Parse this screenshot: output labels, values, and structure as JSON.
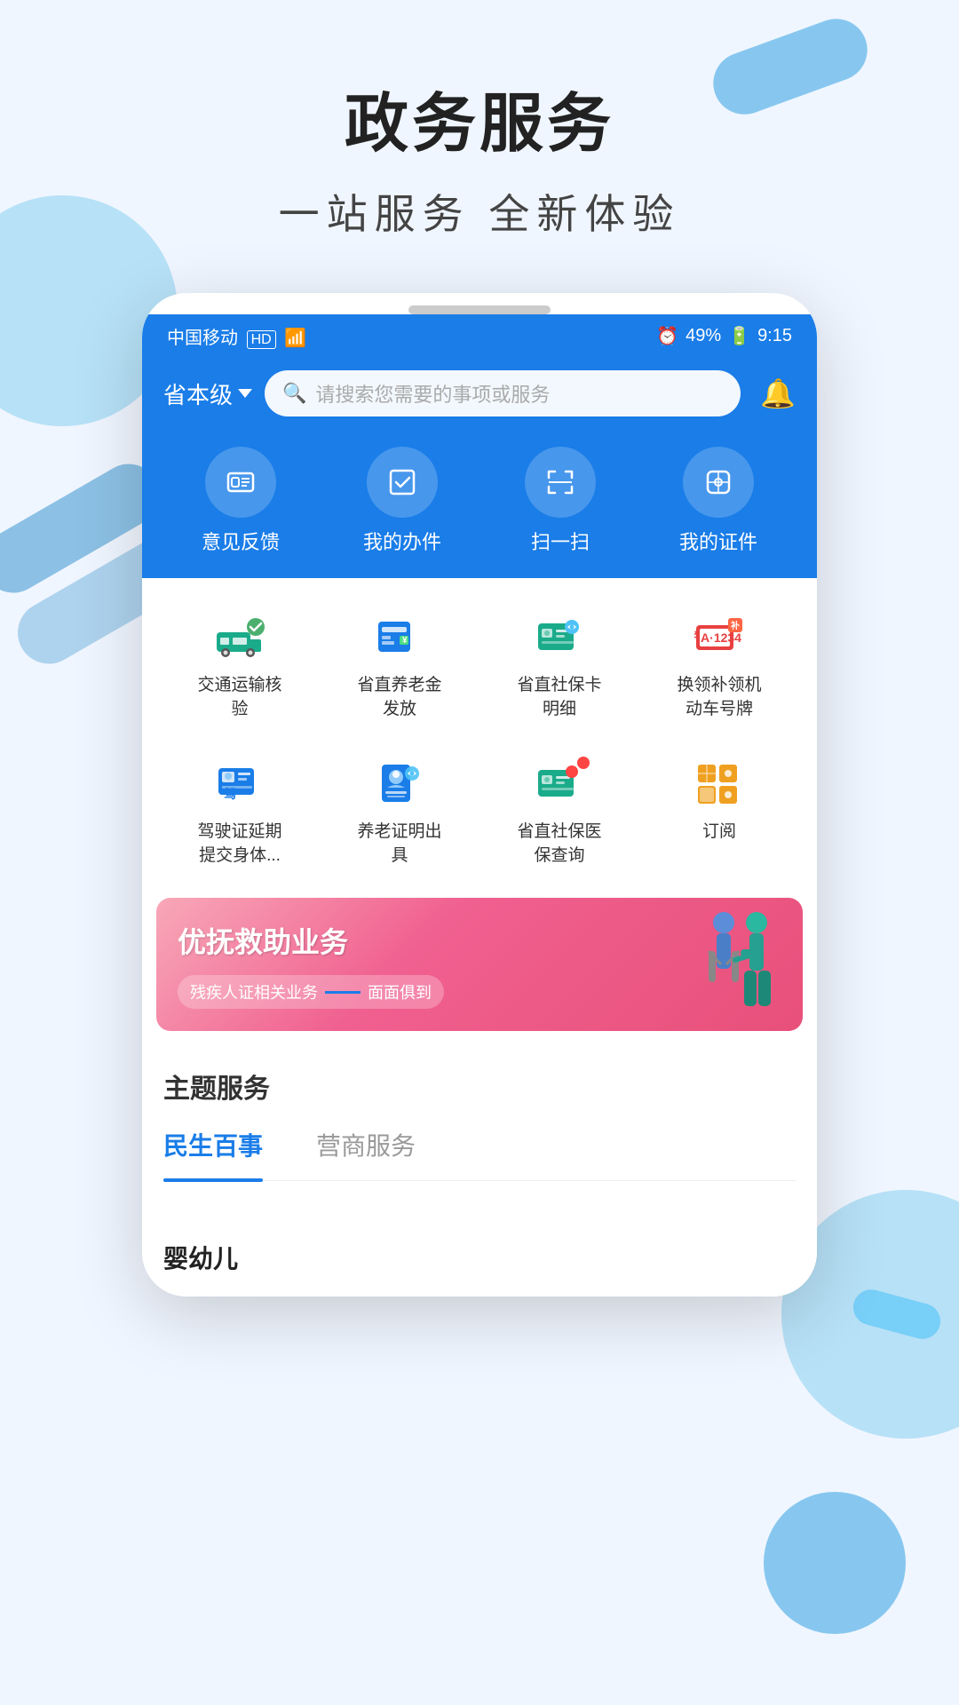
{
  "page": {
    "title": "政务服务",
    "subtitle": "一站服务   全新体验"
  },
  "status_bar": {
    "carrier": "中国移动",
    "hd": "HD",
    "signal": "4G",
    "clock_icon": "⏰",
    "battery": "49%",
    "time": "9:15"
  },
  "app_header": {
    "location": "省本级",
    "search_placeholder": "请搜索您需要的事项或服务"
  },
  "quick_actions": [
    {
      "id": "feedback",
      "label": "意见反馈",
      "icon": "🪪"
    },
    {
      "id": "my-tasks",
      "label": "我的办件",
      "icon": "✅"
    },
    {
      "id": "scan",
      "label": "扫一扫",
      "icon": "⬜"
    },
    {
      "id": "my-id",
      "label": "我的证件",
      "icon": "📦"
    }
  ],
  "services": [
    {
      "id": "transport",
      "label": "交通运输核\n验",
      "color": "#1aab8a",
      "icon": "truck"
    },
    {
      "id": "pension-payment",
      "label": "省直养老金\n发放",
      "color": "#1a7de8",
      "icon": "pension"
    },
    {
      "id": "social-card",
      "label": "省直社保卡\n明细",
      "color": "#1aab8a",
      "icon": "card"
    },
    {
      "id": "plate",
      "label": "换领补领机\n动车号牌",
      "color": "#e84040",
      "icon": "plate"
    },
    {
      "id": "driving",
      "label": "驾驶证延期\n提交身体...",
      "color": "#1a7de8",
      "icon": "driving"
    },
    {
      "id": "pension-cert",
      "label": "养老证明出\n具",
      "color": "#1a7de8",
      "icon": "pension-cert"
    },
    {
      "id": "medical",
      "label": "省直社保医\n保查询",
      "color": "#1aab8a",
      "icon": "medical",
      "badge": true
    },
    {
      "id": "subscribe",
      "label": "订阅",
      "color": "#f0a020",
      "icon": "subscribe"
    }
  ],
  "banner": {
    "title": "优抚救助业务",
    "subtitle_text": "残疾人证相关业务",
    "subtitle_suffix": "面面俱到",
    "bg_gradient_start": "#f8a8b8",
    "bg_gradient_end": "#e8507a"
  },
  "theme_section": {
    "title": "主题服务",
    "tabs": [
      {
        "id": "livelihood",
        "label": "民生百事",
        "active": true
      },
      {
        "id": "business",
        "label": "营商服务",
        "active": false
      }
    ]
  },
  "sub_category": {
    "title": "婴幼儿"
  },
  "colors": {
    "primary": "#1a7de8",
    "green": "#1aab8a",
    "red": "#e84040",
    "orange": "#f0a020",
    "pink": "#f06090"
  }
}
